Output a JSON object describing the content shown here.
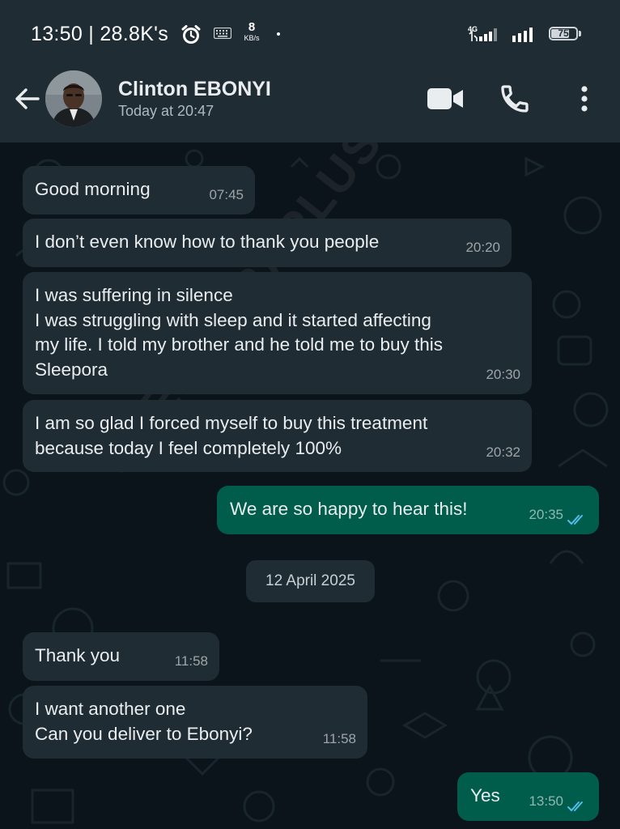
{
  "status_bar": {
    "time": "13:50 | 28.8K's",
    "net_speed_value": "8",
    "net_speed_unit": "KB/s",
    "network_type": "4G",
    "battery_level": "75",
    "icons": [
      "alarm-icon",
      "keyboard-icon",
      "signal-4g-icon",
      "signal-icon",
      "battery-icon"
    ]
  },
  "header": {
    "contact_name": "Clinton EBONYI",
    "last_seen": "Today at 20:47",
    "icons": [
      "back-arrow-icon",
      "video-call-icon",
      "voice-call-icon",
      "more-options-icon"
    ]
  },
  "watermark": "SLEEPORAPLUS",
  "messages": [
    {
      "direction": "in",
      "text": "Good morning",
      "time": "07:45"
    },
    {
      "direction": "in",
      "text": "I don’t even know how to thank you people",
      "time": "20:20"
    },
    {
      "direction": "in",
      "text": "I was suffering in silence\nI was struggling with sleep and it started affecting\nmy life. I told my brother and he told me to buy this\nSleepora",
      "time": "20:30"
    },
    {
      "direction": "in",
      "text": "I am so glad I forced myself to buy this treatment\nbecause today I feel completely 100%",
      "time": "20:32"
    },
    {
      "direction": "out",
      "text": "We are so happy to hear this!",
      "time": "20:35",
      "status": "read"
    },
    {
      "direction": "in",
      "text": "Thank you",
      "time": "11:58"
    },
    {
      "direction": "in",
      "text": "I want another one\nCan you deliver to Ebonyi?",
      "time": "11:58"
    },
    {
      "direction": "out",
      "text": "Yes",
      "time": "13:50",
      "status": "read"
    }
  ],
  "date_divider": "12 April 2025",
  "colors": {
    "header_bg": "#1f2c34",
    "chat_bg": "#0b141a",
    "incoming_bubble": "#202c33",
    "outgoing_bubble": "#005c4b",
    "read_ticks": "#53bdeb"
  }
}
